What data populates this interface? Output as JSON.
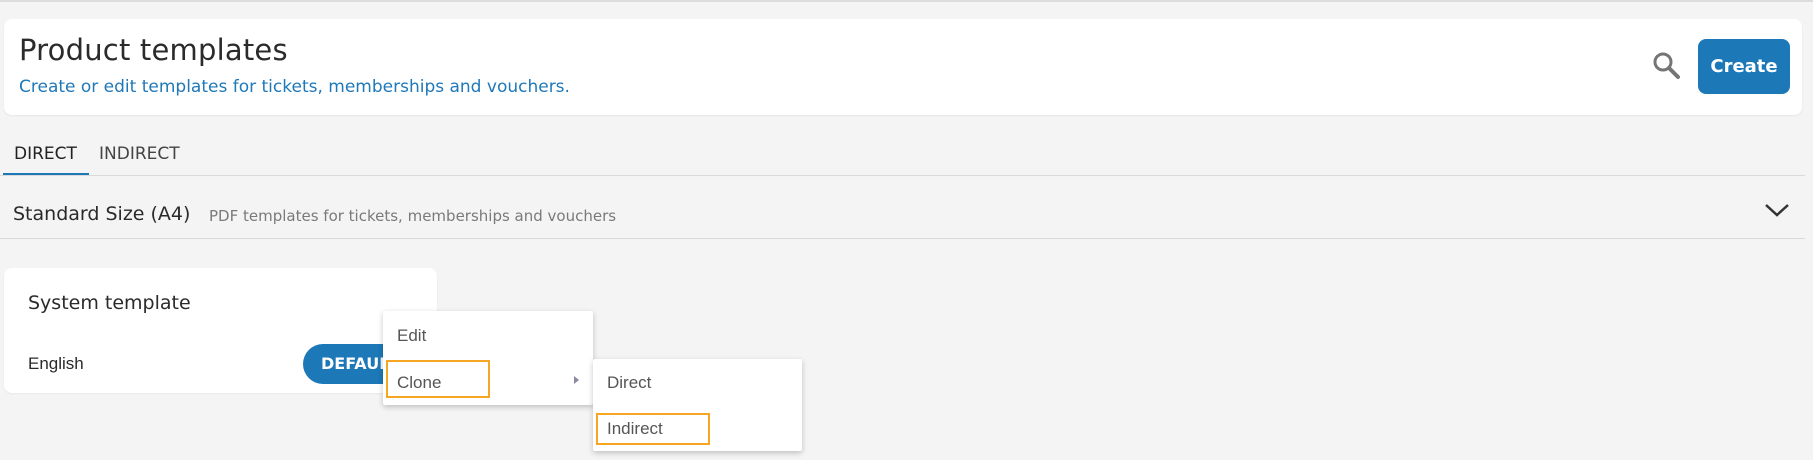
{
  "header": {
    "title": "Product templates",
    "subtitle": "Create or edit templates for tickets, memberships and vouchers.",
    "search_icon": "search-icon",
    "create_label": "Create"
  },
  "tabs": [
    {
      "label": "DIRECT",
      "selected": true
    },
    {
      "label": "INDIRECT",
      "selected": false
    }
  ],
  "section": {
    "title": "Standard Size (A4)",
    "description": "PDF templates for tickets, memberships and vouchers",
    "toggle_icon": "chevron-down-icon"
  },
  "template_card": {
    "title": "System template",
    "language": "English",
    "badge": "DEFAULT"
  },
  "context_menu": {
    "items": [
      {
        "label": "Edit"
      },
      {
        "label": "Clone",
        "has_submenu": true,
        "highlighted": true
      }
    ]
  },
  "clone_submenu": {
    "items": [
      {
        "label": "Direct"
      },
      {
        "label": "Indirect",
        "highlighted": true
      }
    ]
  },
  "colors": {
    "accent": "#1d78b8",
    "highlight": "#f5a623",
    "background": "#f4f4f4"
  }
}
